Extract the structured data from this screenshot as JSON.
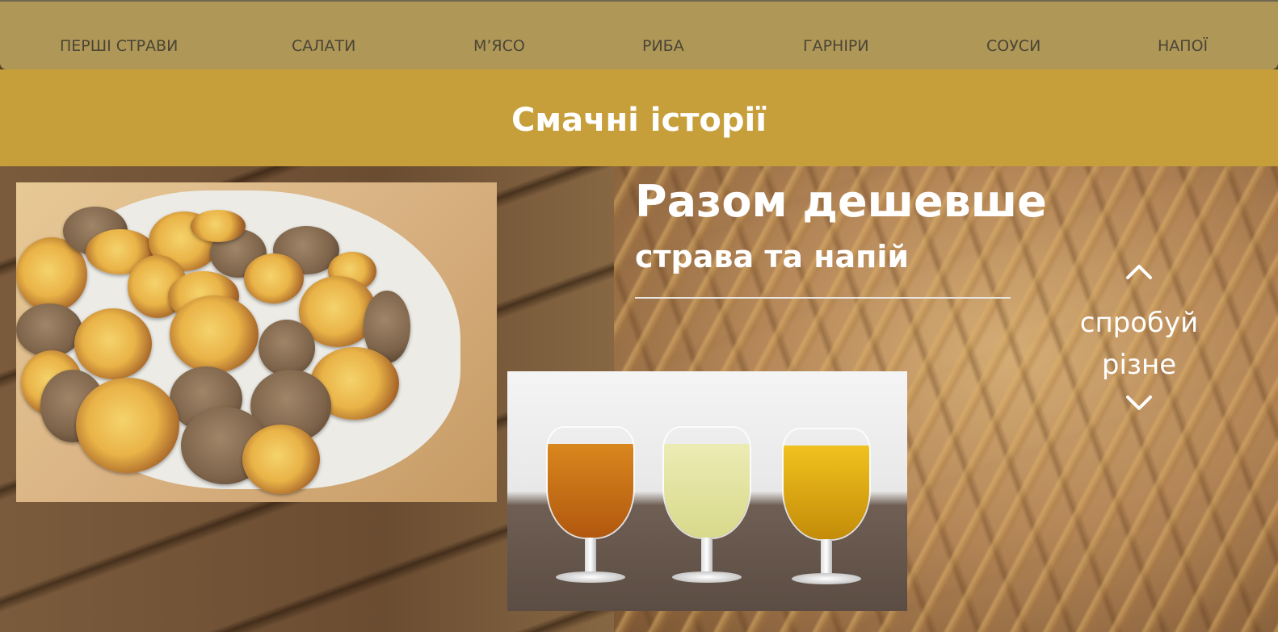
{
  "nav": {
    "items": [
      {
        "label": "ПЕРШІ СТРАВИ"
      },
      {
        "label": "САЛАТИ"
      },
      {
        "label": "М’ЯСО"
      },
      {
        "label": "РИБА"
      },
      {
        "label": "ГАРНІРИ"
      },
      {
        "label": "СОУСИ"
      },
      {
        "label": "НАПОЇ"
      }
    ]
  },
  "header": {
    "title": "Смачні історії"
  },
  "promo": {
    "title": "Разом дешевше",
    "subtitle": "страва та напій"
  },
  "switcher": {
    "line1": "спробуй",
    "line2": "різне",
    "up_icon": "chevron-up-icon",
    "down_icon": "chevron-down-icon"
  },
  "images": {
    "food": "roasted-potatoes-photo",
    "drinks": "three-glasses-of-drinks-photo"
  },
  "colors": {
    "nav_bg": "#ae9757",
    "title_band_bg": "#c69e3a",
    "nav_text": "#4b4536",
    "hero_text": "#ffffff"
  }
}
